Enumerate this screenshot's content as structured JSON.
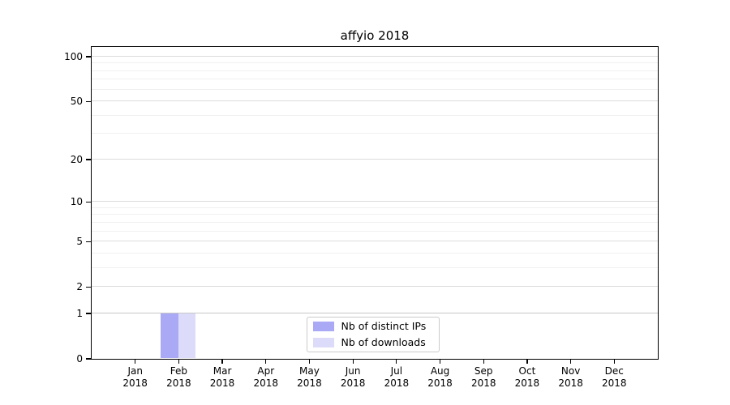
{
  "chart_data": {
    "type": "bar",
    "title": "affyio 2018",
    "categories": [
      {
        "month": "Jan",
        "year": "2018"
      },
      {
        "month": "Feb",
        "year": "2018"
      },
      {
        "month": "Mar",
        "year": "2018"
      },
      {
        "month": "Apr",
        "year": "2018"
      },
      {
        "month": "May",
        "year": "2018"
      },
      {
        "month": "Jun",
        "year": "2018"
      },
      {
        "month": "Jul",
        "year": "2018"
      },
      {
        "month": "Aug",
        "year": "2018"
      },
      {
        "month": "Sep",
        "year": "2018"
      },
      {
        "month": "Oct",
        "year": "2018"
      },
      {
        "month": "Nov",
        "year": "2018"
      },
      {
        "month": "Dec",
        "year": "2018"
      }
    ],
    "series": [
      {
        "name": "Nb of distinct IPs",
        "color": "#a9a9f5",
        "values": [
          0,
          1,
          0,
          0,
          0,
          0,
          0,
          0,
          0,
          0,
          0,
          0
        ]
      },
      {
        "name": "Nb of downloads",
        "color": "#dcdcfa",
        "values": [
          0,
          1,
          0,
          0,
          0,
          0,
          0,
          0,
          0,
          0,
          0,
          0
        ]
      }
    ],
    "yscale": "log1p",
    "ylim": [
      0,
      100
    ],
    "yticks": [
      0,
      1,
      2,
      5,
      10,
      20,
      50,
      100
    ],
    "yticks_minor": [
      3,
      4,
      6,
      7,
      8,
      9,
      30,
      40,
      60,
      70,
      80,
      90
    ],
    "xlabel": "",
    "ylabel": "",
    "grid": true,
    "legend_position": "bottom-center"
  },
  "colors": {
    "axis": "#000000",
    "major_grid": "#dcdcdc",
    "minor_grid": "#f0f0f0",
    "one_line_grid": "#c6c6c6",
    "legend_border": "#cbcbcb",
    "background": "#ffffff"
  }
}
